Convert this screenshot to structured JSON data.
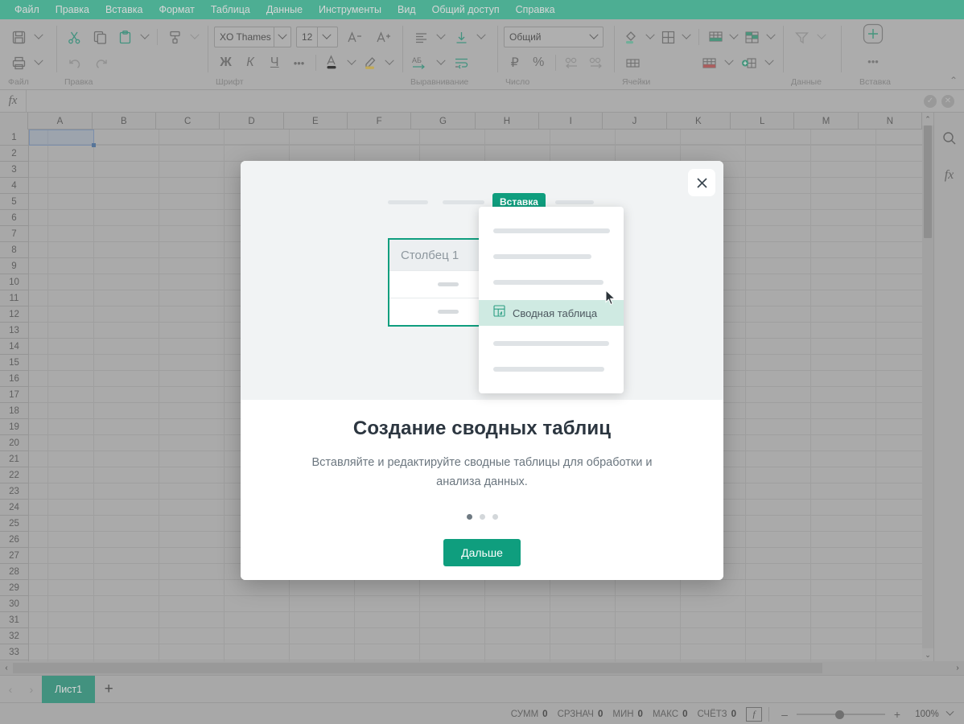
{
  "menubar": {
    "items": [
      {
        "label": "Файл",
        "name": "menu-file"
      },
      {
        "label": "Правка",
        "name": "menu-edit"
      },
      {
        "label": "Вставка",
        "name": "menu-insert"
      },
      {
        "label": "Формат",
        "name": "menu-format"
      },
      {
        "label": "Таблица",
        "name": "menu-table"
      },
      {
        "label": "Данные",
        "name": "menu-data"
      },
      {
        "label": "Инструменты",
        "name": "menu-tools"
      },
      {
        "label": "Вид",
        "name": "menu-view"
      },
      {
        "label": "Общий доступ",
        "name": "menu-share"
      },
      {
        "label": "Справка",
        "name": "menu-help"
      }
    ]
  },
  "toolbar": {
    "groups": [
      {
        "label": "Файл"
      },
      {
        "label": "Правка"
      },
      {
        "label": "Шрифт"
      },
      {
        "label": "Выравнивание"
      },
      {
        "label": "Число"
      },
      {
        "label": "Ячейки"
      },
      {
        "label": "Данные"
      },
      {
        "label": "Вставка"
      }
    ],
    "font_name": "XO Thames",
    "font_size": "12",
    "number_format": "Общий",
    "bold_glyph": "Ж",
    "italic_glyph": "К",
    "underline_glyph": "Ч",
    "more_glyph": "•••",
    "font_color_glyph": "A",
    "wrap_glyph": "АБ",
    "currency_glyph": "₽",
    "percent_glyph": "%",
    "collapse_glyph": "⌃"
  },
  "formula_bar": {
    "fx_glyph": "fx",
    "value": "",
    "accept_glyph": "✓",
    "cancel_glyph": "✕"
  },
  "grid": {
    "columns": [
      "A",
      "B",
      "C",
      "D",
      "E",
      "F",
      "G",
      "H",
      "I",
      "J",
      "K",
      "L",
      "M",
      "N"
    ],
    "rows": [
      "1",
      "2",
      "3",
      "4",
      "5",
      "6",
      "7",
      "8",
      "9",
      "10",
      "11",
      "12",
      "13",
      "14",
      "15",
      "16",
      "17",
      "18",
      "19",
      "20",
      "21",
      "22",
      "23",
      "24",
      "25",
      "26",
      "27",
      "28",
      "29",
      "30",
      "31",
      "32",
      "33"
    ],
    "selected_cell": "A1"
  },
  "rail": {
    "search_icon": "search-icon",
    "fx_icon": "fx",
    "fx_glyph": "fx"
  },
  "sheetbar": {
    "prev_glyph": "‹",
    "next_glyph": "›",
    "tabs": [
      {
        "label": "Лист1"
      }
    ],
    "add_glyph": "+"
  },
  "statusbar": {
    "stats": [
      {
        "label": "СУММ",
        "value": "0"
      },
      {
        "label": "СРЗНАЧ",
        "value": "0"
      },
      {
        "label": "МИН",
        "value": "0"
      },
      {
        "label": "МАКС",
        "value": "0"
      },
      {
        "label": "СЧЁТЗ",
        "value": "0"
      }
    ],
    "fx_glyph": "f",
    "zoom_out_glyph": "–",
    "zoom_in_glyph": "+",
    "zoom_level": "100%"
  },
  "modal": {
    "close_glyph": "✕",
    "faux_tab_label": "Вставка",
    "dropdown_item_label": "Сводная таблица",
    "dropdown_item_icon": "pivot-table-icon",
    "illustration_column_header": "Столбец 1",
    "title": "Создание сводных таблиц",
    "description": "Вставляйте и редактируйте сводные таблицы для обработки и анализа данных.",
    "dots_total": 3,
    "dots_active_index": 0,
    "next_button_label": "Дальше"
  },
  "colors": {
    "menubar_green": "#3bc6a0",
    "accent_green": "#0f9e7e",
    "sheet_tab_green": "#2b9e83",
    "highlight_mint": "#cfeae2",
    "chrome_grey": "#bdbdbd",
    "modal_hero_bg": "#f1f3f4",
    "title_text": "#2c3640",
    "desc_text": "#6b767f"
  }
}
